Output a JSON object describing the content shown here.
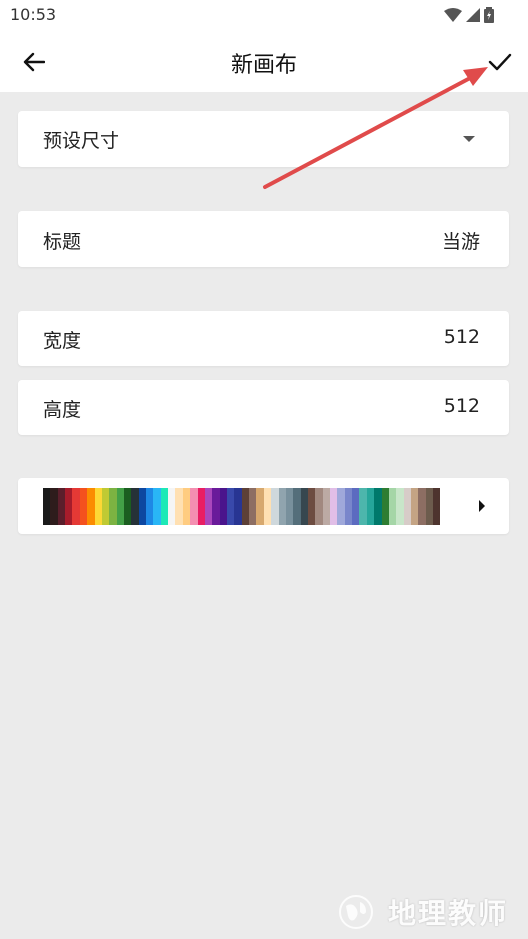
{
  "status": {
    "time": "10:53"
  },
  "header": {
    "title": "新画布",
    "back_icon": "arrow-left-icon",
    "confirm_icon": "check-icon"
  },
  "preset": {
    "label": "预设尺寸"
  },
  "title_row": {
    "label": "标题",
    "value": "当游"
  },
  "width_row": {
    "label": "宽度",
    "value": "512"
  },
  "height_row": {
    "label": "高度",
    "value": "512"
  },
  "palette": {
    "colors": [
      "#1a1a1a",
      "#2e1c1c",
      "#5a1e2b",
      "#a61c2b",
      "#e53935",
      "#f4511e",
      "#fb8c00",
      "#fdd835",
      "#c0ca33",
      "#7cb342",
      "#43a047",
      "#1b5e20",
      "#263238",
      "#0d47a1",
      "#1e88e5",
      "#29b6f6",
      "#1de9b6",
      "#f5f5f5",
      "#ffe0b2",
      "#ffcc80",
      "#f48fb1",
      "#e91e63",
      "#ab47bc",
      "#6a1b9a",
      "#4a148c",
      "#3949ab",
      "#283593",
      "#5d4037",
      "#8d6e63",
      "#d7a86e",
      "#ffe0b2",
      "#cfd8dc",
      "#90a4ae",
      "#78909c",
      "#546e7a",
      "#37474f",
      "#6d4c41",
      "#a1887f",
      "#bcaaa4",
      "#e1bee7",
      "#9fa8da",
      "#7986cb",
      "#5c6bc0",
      "#4db6ac",
      "#26a69a",
      "#00796b",
      "#2e7d32",
      "#a5d6a7",
      "#c8e6c9",
      "#d7ccc8",
      "#c4a484",
      "#8d6e63",
      "#6d5c4d",
      "#4e342e"
    ]
  },
  "annotation": {
    "color": "#e04b4b"
  },
  "watermark": {
    "text": "地理教师"
  }
}
